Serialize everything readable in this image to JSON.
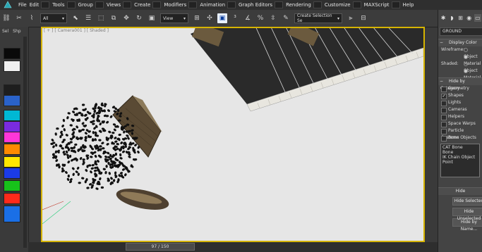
{
  "menu": {
    "items": [
      {
        "label": "File"
      },
      {
        "label": "Edit"
      },
      {
        "label": "Tools"
      },
      {
        "label": "Group"
      },
      {
        "label": "Views"
      },
      {
        "label": "Create"
      },
      {
        "label": "Modifiers"
      },
      {
        "label": "Animation"
      },
      {
        "label": "Graph Editors"
      },
      {
        "label": "Rendering"
      },
      {
        "label": "Customize"
      },
      {
        "label": "MAXScript"
      },
      {
        "label": "Help"
      }
    ]
  },
  "toolbar": {
    "filter_value": "All",
    "view_value": "View",
    "selection_set_placeholder": "Create Selection Se"
  },
  "left_panel": {
    "tab1": "Sel",
    "tab2": "Shp"
  },
  "swatches": [
    "#0a0a0a",
    "#f0f0f0",
    "#1e1e1e",
    "#2a62c9",
    "#00b8d4",
    "#7a2be0",
    "#ff36d8",
    "#ff8a00",
    "#ffe600",
    "#1b3be8",
    "#17c21a",
    "#ff2a1a",
    "#1a6fe6"
  ],
  "viewport": {
    "label": "[ + ] [ Camera001 ] [ Shaded ]"
  },
  "timeline": {
    "frame": "97 / 150"
  },
  "command_panel": {
    "object_name": "GROUND",
    "display_color": "Display Color",
    "wireframe_label": "Wireframe:",
    "shaded_label": "Shaded:",
    "opt_object": "Object",
    "opt_material": "Material",
    "hide_by_category": "Hide by Category",
    "categories": [
      "Geometry",
      "Shapes",
      "Lights",
      "Cameras",
      "Helpers",
      "Space Warps",
      "Particle Systems",
      "Bone Objects"
    ],
    "list_items": [
      "CAT Bone",
      "Bone",
      "IK Chain Object",
      "Point"
    ],
    "hide": "Hide",
    "hide_selected": "Hide Selected",
    "hide_unselected": "Hide Unselected",
    "hide_by_name": "Hide by Name..."
  }
}
